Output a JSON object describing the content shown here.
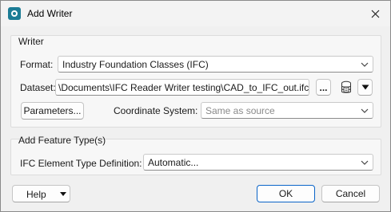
{
  "window": {
    "title": "Add Writer",
    "close_glyph": "✕"
  },
  "writer_group": {
    "title": "Writer",
    "format_label": "Format:",
    "format_value": "Industry Foundation Classes (IFC)",
    "dataset_label": "Dataset:",
    "dataset_value": "\\Documents\\IFC Reader Writer testing\\CAD_to_IFC_out.ifc\"",
    "browse_label": "...",
    "parameters_label": "Parameters...",
    "coord_label": "Coordinate System:",
    "coord_placeholder": "Same as source"
  },
  "feature_group": {
    "title": "Add Feature Type(s)",
    "element_label": "IFC Element Type Definition:",
    "element_value": "Automatic..."
  },
  "footer": {
    "help_label": "Help",
    "ok_label": "OK",
    "cancel_label": "Cancel"
  },
  "icons": {
    "app": "fme-app-icon",
    "close": "close-icon",
    "chevron": "chevron-down-icon",
    "database": "database-icon",
    "triangle": "triangle-down-icon"
  },
  "colors": {
    "accent": "#0a64c8",
    "app_icon": "#1c7c95"
  }
}
